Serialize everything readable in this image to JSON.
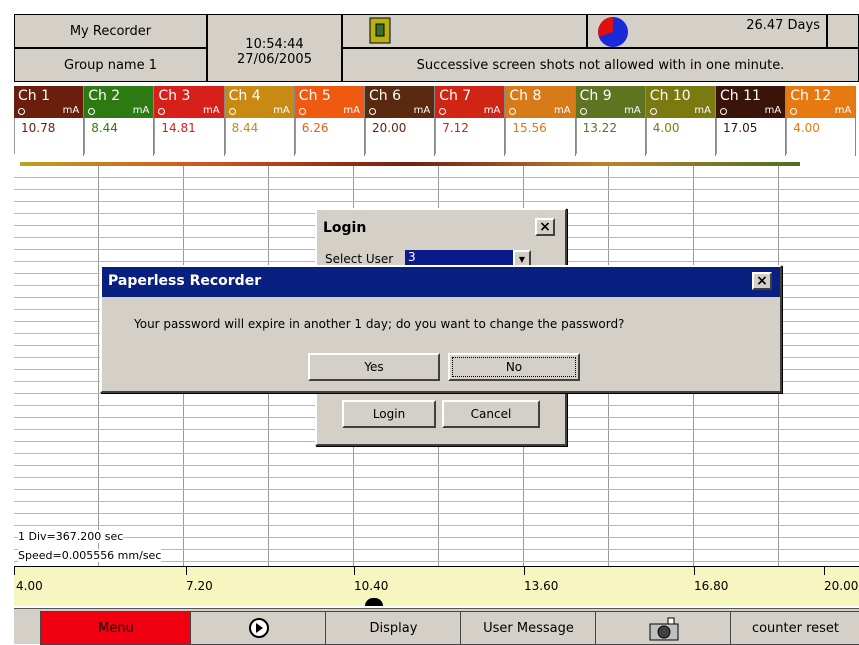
{
  "header": {
    "recorder_name": "My Recorder",
    "group_name": "Group name 1",
    "time": "10:54:44",
    "date": "27/06/2005",
    "days": "26.47 Days",
    "status_message": "Successive screen shots not allowed with in one minute."
  },
  "channels": [
    {
      "name": "Ch 1",
      "unit": "mA",
      "value": "10.78",
      "color": "#6b1e0c"
    },
    {
      "name": "Ch 2",
      "unit": "mA",
      "value": "8.44",
      "color": "#2e7a12"
    },
    {
      "name": "Ch 3",
      "unit": "mA",
      "value": "14.81",
      "color": "#d8201a"
    },
    {
      "name": "Ch 4",
      "unit": "mA",
      "value": "8.44",
      "color": "#c98a14"
    },
    {
      "name": "Ch 5",
      "unit": "mA",
      "value": "6.26",
      "color": "#f05a10"
    },
    {
      "name": "Ch 6",
      "unit": "mA",
      "value": "20.00",
      "color": "#5a2a10"
    },
    {
      "name": "Ch 7",
      "unit": "mA",
      "value": "7.12",
      "color": "#d02414"
    },
    {
      "name": "Ch 8",
      "unit": "mA",
      "value": "15.56",
      "color": "#d77a18"
    },
    {
      "name": "Ch 9",
      "unit": "mA",
      "value": "13.22",
      "color": "#5e7420"
    },
    {
      "name": "Ch 10",
      "unit": "mA",
      "value": "4.00",
      "color": "#7a7a10"
    },
    {
      "name": "Ch 11",
      "unit": "mA",
      "value": "17.05",
      "color": "#3a1408"
    },
    {
      "name": "Ch 12",
      "unit": "mA",
      "value": "4.00",
      "color": "#e67a10"
    }
  ],
  "chart": {
    "div_text": "1 Div=367.200 sec",
    "speed_text": "Speed=0.005556 mm/sec",
    "scale_labels": [
      "4.00",
      "7.20",
      "10.40",
      "13.60",
      "16.80",
      "20.00"
    ]
  },
  "login_dialog": {
    "title": "Login",
    "select_user_label": "Select User",
    "selected_user": "3",
    "login_button": "Login",
    "cancel_button": "Cancel",
    "close_glyph": "×"
  },
  "password_dialog": {
    "title": "Paperless Recorder",
    "message": "Your password will expire in another 1 day; do you want to change the password?",
    "yes_button": "Yes",
    "no_button": "No",
    "close_glyph": "×"
  },
  "bottom_bar": {
    "menu": "Menu",
    "display": "Display",
    "user_message": "User Message",
    "counter_reset": "counter reset"
  }
}
